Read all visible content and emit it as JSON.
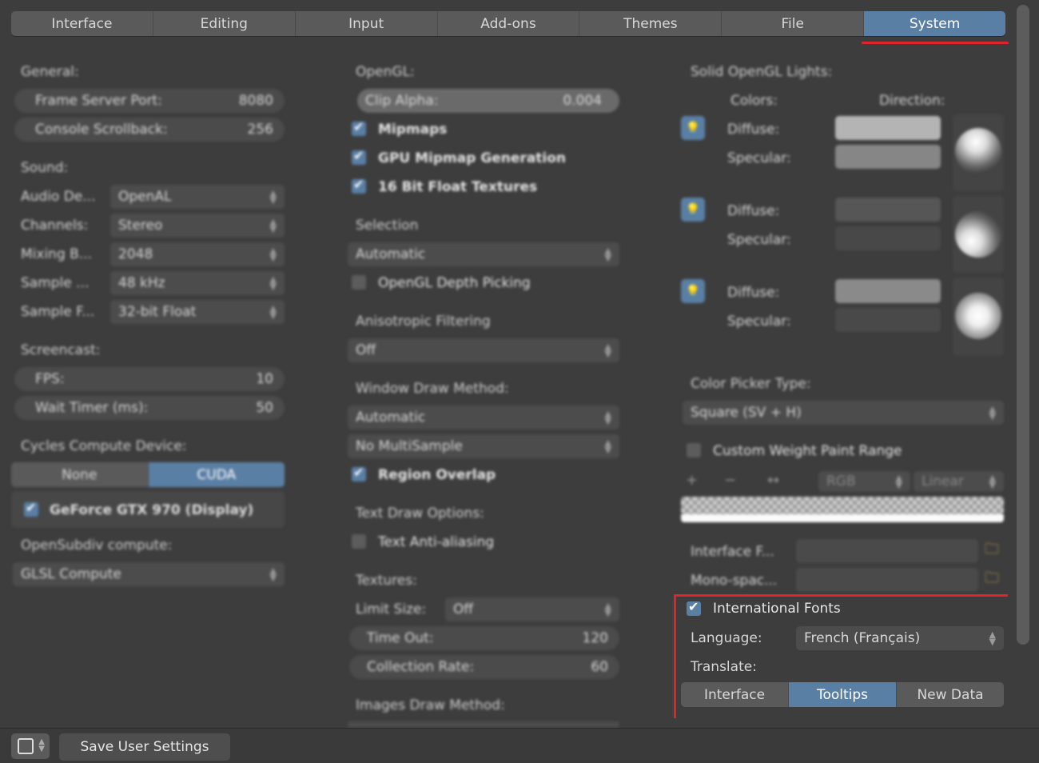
{
  "tabs": [
    {
      "label": "Interface",
      "active": false
    },
    {
      "label": "Editing",
      "active": false
    },
    {
      "label": "Input",
      "active": false
    },
    {
      "label": "Add-ons",
      "active": false
    },
    {
      "label": "Themes",
      "active": false
    },
    {
      "label": "File",
      "active": false
    },
    {
      "label": "System",
      "active": true
    }
  ],
  "colors": {
    "accent": "#5a7fa5",
    "highlight_red": "#e0242b",
    "bg": "#3d3d3d"
  },
  "general": {
    "title": "General:",
    "frame_server_port": {
      "label": "Frame Server Port:",
      "value": "8080"
    },
    "console_scrollback": {
      "label": "Console Scrollback:",
      "value": "256"
    }
  },
  "sound": {
    "title": "Sound:",
    "rows": [
      {
        "label": "Audio De...",
        "value": "OpenAL"
      },
      {
        "label": "Channels:",
        "value": "Stereo"
      },
      {
        "label": "Mixing B...",
        "value": "2048"
      },
      {
        "label": "Sample ...",
        "value": "48 kHz"
      },
      {
        "label": "Sample F...",
        "value": "32-bit Float"
      }
    ]
  },
  "screencast": {
    "title": "Screencast:",
    "fps": {
      "label": "FPS:",
      "value": "10"
    },
    "wait_timer": {
      "label": "Wait Timer (ms):",
      "value": "50"
    }
  },
  "cycles": {
    "title": "Cycles Compute Device:",
    "options": [
      "None",
      "CUDA"
    ],
    "selected": "CUDA",
    "device": "GeForce GTX 970 (Display)"
  },
  "opensubdiv": {
    "title": "OpenSubdiv compute:",
    "value": "GLSL Compute"
  },
  "opengl": {
    "title": "OpenGL:",
    "clip_alpha": {
      "label": "Clip Alpha:",
      "value": "0.004"
    },
    "mipmaps": "Mipmaps",
    "gpu_mipmap": "GPU Mipmap Generation",
    "float_textures": "16 Bit Float Textures"
  },
  "selection": {
    "title": "Selection",
    "value": "Automatic",
    "depth_picking": "OpenGL Depth Picking"
  },
  "anisotropic": {
    "title": "Anisotropic Filtering",
    "value": "Off"
  },
  "window_draw": {
    "title": "Window Draw Method:",
    "method": "Automatic",
    "multisample": "No MultiSample",
    "region_overlap": "Region Overlap"
  },
  "text_draw": {
    "title": "Text Draw Options:",
    "anti_aliasing": "Text Anti-aliasing"
  },
  "textures": {
    "title": "Textures:",
    "limit_size": {
      "label": "Limit Size:",
      "value": "Off"
    },
    "time_out": {
      "label": "Time Out:",
      "value": "120"
    },
    "collection_rate": {
      "label": "Collection Rate:",
      "value": "60"
    }
  },
  "images_draw": {
    "title": "Images Draw Method:"
  },
  "lights": {
    "title": "Solid OpenGL Lights:",
    "colors_label": "Colors:",
    "direction_label": "Direction:",
    "diffuse": "Diffuse:",
    "specular": "Specular:"
  },
  "color_picker": {
    "title": "Color Picker Type:",
    "value": "Square (SV + H)"
  },
  "weight_paint": {
    "label": "Custom Weight Paint Range",
    "tools": [
      "+",
      "−",
      "↔"
    ],
    "mode": "RGB",
    "interp": "Linear"
  },
  "fonts": {
    "interface_label": "Interface F...",
    "mono_label": "Mono-spac..."
  },
  "international": {
    "label": "International Fonts",
    "language_label": "Language:",
    "language_value": "French (Français)",
    "translate_label": "Translate:",
    "translate_options": [
      "Interface",
      "Tooltips",
      "New Data"
    ],
    "translate_active": "Tooltips"
  },
  "footer": {
    "save_label": "Save User Settings"
  }
}
